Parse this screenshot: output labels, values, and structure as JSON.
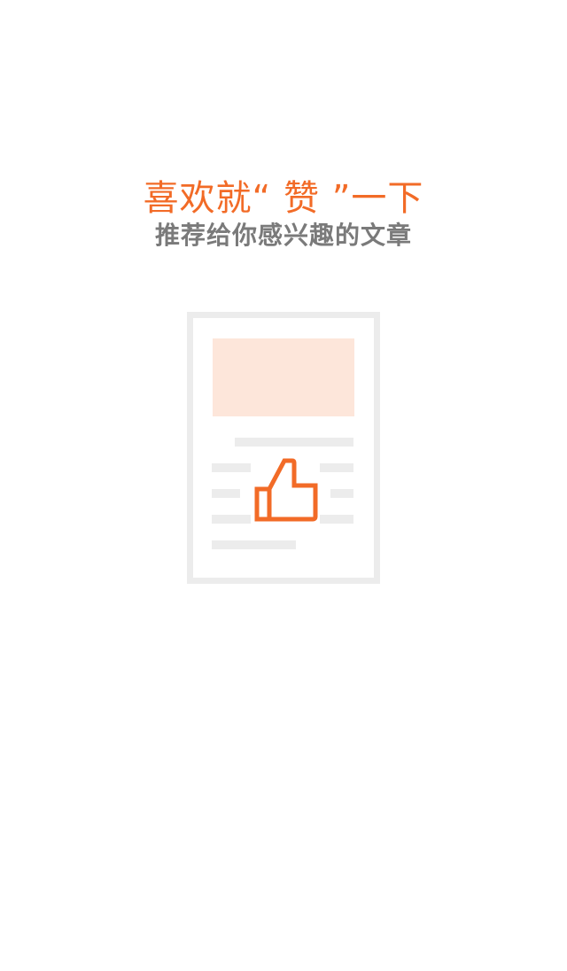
{
  "empty_state": {
    "headline": "喜欢就“ 赞 ”一下",
    "subline": "推荐给你感兴趣的文章",
    "illustration_icon": "article-thumbs-up-icon"
  },
  "colors": {
    "accent": "#f26b27",
    "subtitle_gray": "#7a7a7a",
    "card_border": "#ececec",
    "image_placeholder": "#fde6da",
    "line_gray": "#ececec",
    "background": "#ffffff"
  }
}
